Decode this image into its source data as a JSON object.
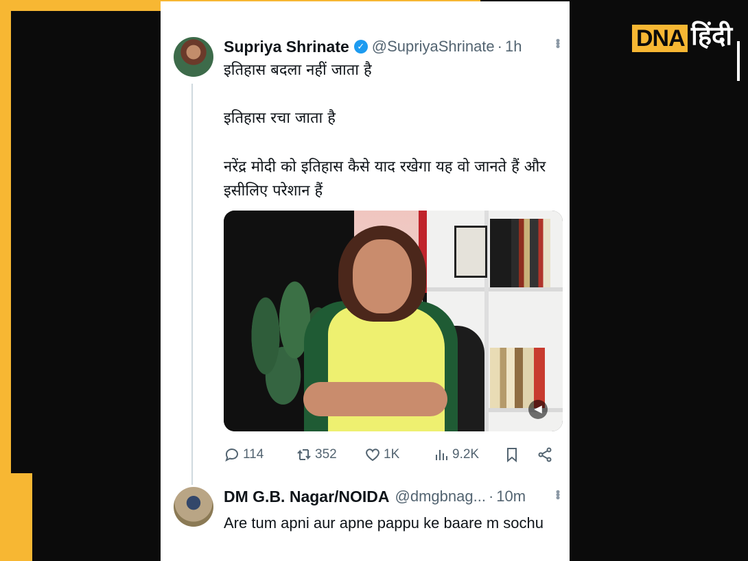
{
  "brand": {
    "logo_latin": "DNA",
    "logo_hindi": "हिंदी",
    "accent": "#f7b733"
  },
  "tweet": {
    "author_name": "Supriya Shrinate",
    "verified_icon": "verified-badge-icon",
    "handle": "@SupriyaShrinate",
    "separator": "·",
    "time": "1h",
    "lines": [
      "इतिहास बदला नहीं जाता है",
      "इतिहास रचा जाता है",
      "नरेंद्र मोदी को इतिहास कैसे याद रखेगा यह वो जानते हैं और",
      "इसीलिए परेशान हैं"
    ],
    "media_icon": "volume-icon",
    "stats": {
      "replies": "114",
      "retweets": "352",
      "likes": "1K",
      "views": "9.2K"
    }
  },
  "reply": {
    "author_name": "DM G.B. Nagar/NOIDA",
    "handle": "@dmgbnag...",
    "separator": "·",
    "time": "10m",
    "text": "Are tum apni aur apne pappu ke baare m sochu"
  }
}
